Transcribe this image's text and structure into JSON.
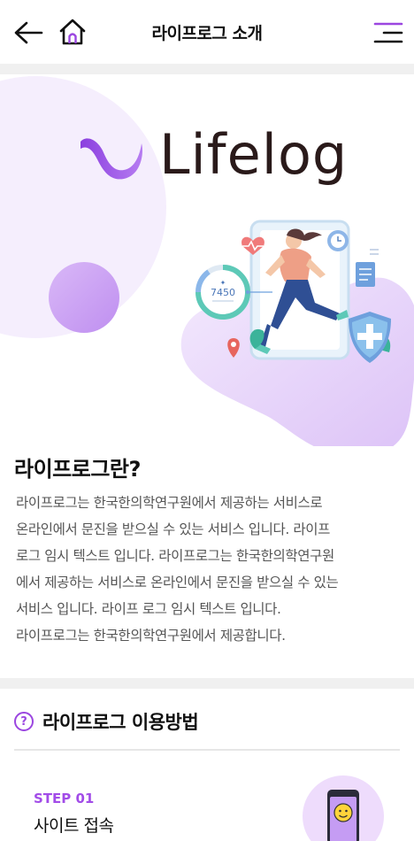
{
  "header": {
    "title": "라이프로그 소개"
  },
  "hero": {
    "brand": "Lifelog",
    "steps_count": "7450",
    "colors": {
      "purple": "#9b46e0",
      "lavender": "#e8d6fb",
      "brand_dark": "#2a1a1a"
    }
  },
  "about": {
    "title": "라이프로그란?",
    "lines": [
      "라이프로그는 한국한의학연구원에서 제공하는 서비스로",
      "온라인에서 문진을 받으실 수 있는 서비스 입니다. 라이프",
      "로그 임시 텍스트 입니다. 라이프로그는 한국한의학연구원",
      "에서 제공하는 서비스로  온라인에서 문진을 받으실 수 있는",
      "서비스 입니다. 라이프 로그 임시 텍스트 입니다.",
      "라이프로그는 한국한의학연구원에서 제공합니다."
    ]
  },
  "usage": {
    "title": "라이프로그 이용방법",
    "help_glyph": "?",
    "steps": [
      {
        "label": "STEP 01",
        "title": "사이트 접속"
      }
    ]
  }
}
